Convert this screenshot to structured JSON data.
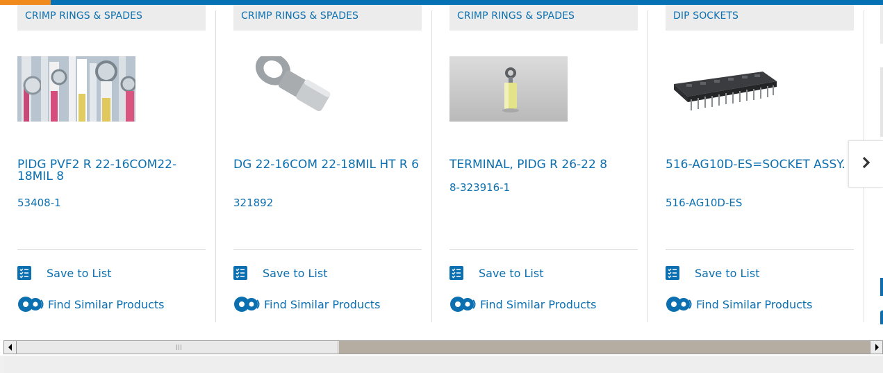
{
  "colors": {
    "brand": "#0b6fb0",
    "accent": "#f08a1c",
    "topbar": "#0672b5"
  },
  "products": [
    {
      "category": "CRIMP RINGS & SPADES",
      "title": "PIDG PVF2 R 22-16COM22-18MIL 8",
      "part_number": "53408-1",
      "image": "crimp-terminals-assortment-photo",
      "save_label": "Save to List",
      "similar_label": "Find Similar Products"
    },
    {
      "category": "CRIMP RINGS & SPADES",
      "title": "DG 22-16COM 22-18MIL HT R 6",
      "part_number": "321892",
      "image": "ring-terminal-photo",
      "save_label": "Save to List",
      "similar_label": "Find Similar Products"
    },
    {
      "category": "CRIMP RINGS & SPADES",
      "title": "TERMINAL, PIDG R 26-22 8",
      "part_number": "8-323916-1",
      "image": "yellow-ring-terminal-photo",
      "save_label": "Save to List",
      "similar_label": "Find Similar Products"
    },
    {
      "category": "DIP SOCKETS",
      "title": "516-AG10D-ES=SOCKET ASSY.",
      "part_number": "516-AG10D-ES",
      "image": "dip-socket-photo",
      "save_label": "Save to List",
      "similar_label": "Find Similar Products"
    }
  ],
  "next_icon": "chevron-right-icon",
  "scrollbar": {
    "left_icon": "scroll-left-arrow-icon",
    "right_icon": "scroll-right-arrow-icon"
  }
}
